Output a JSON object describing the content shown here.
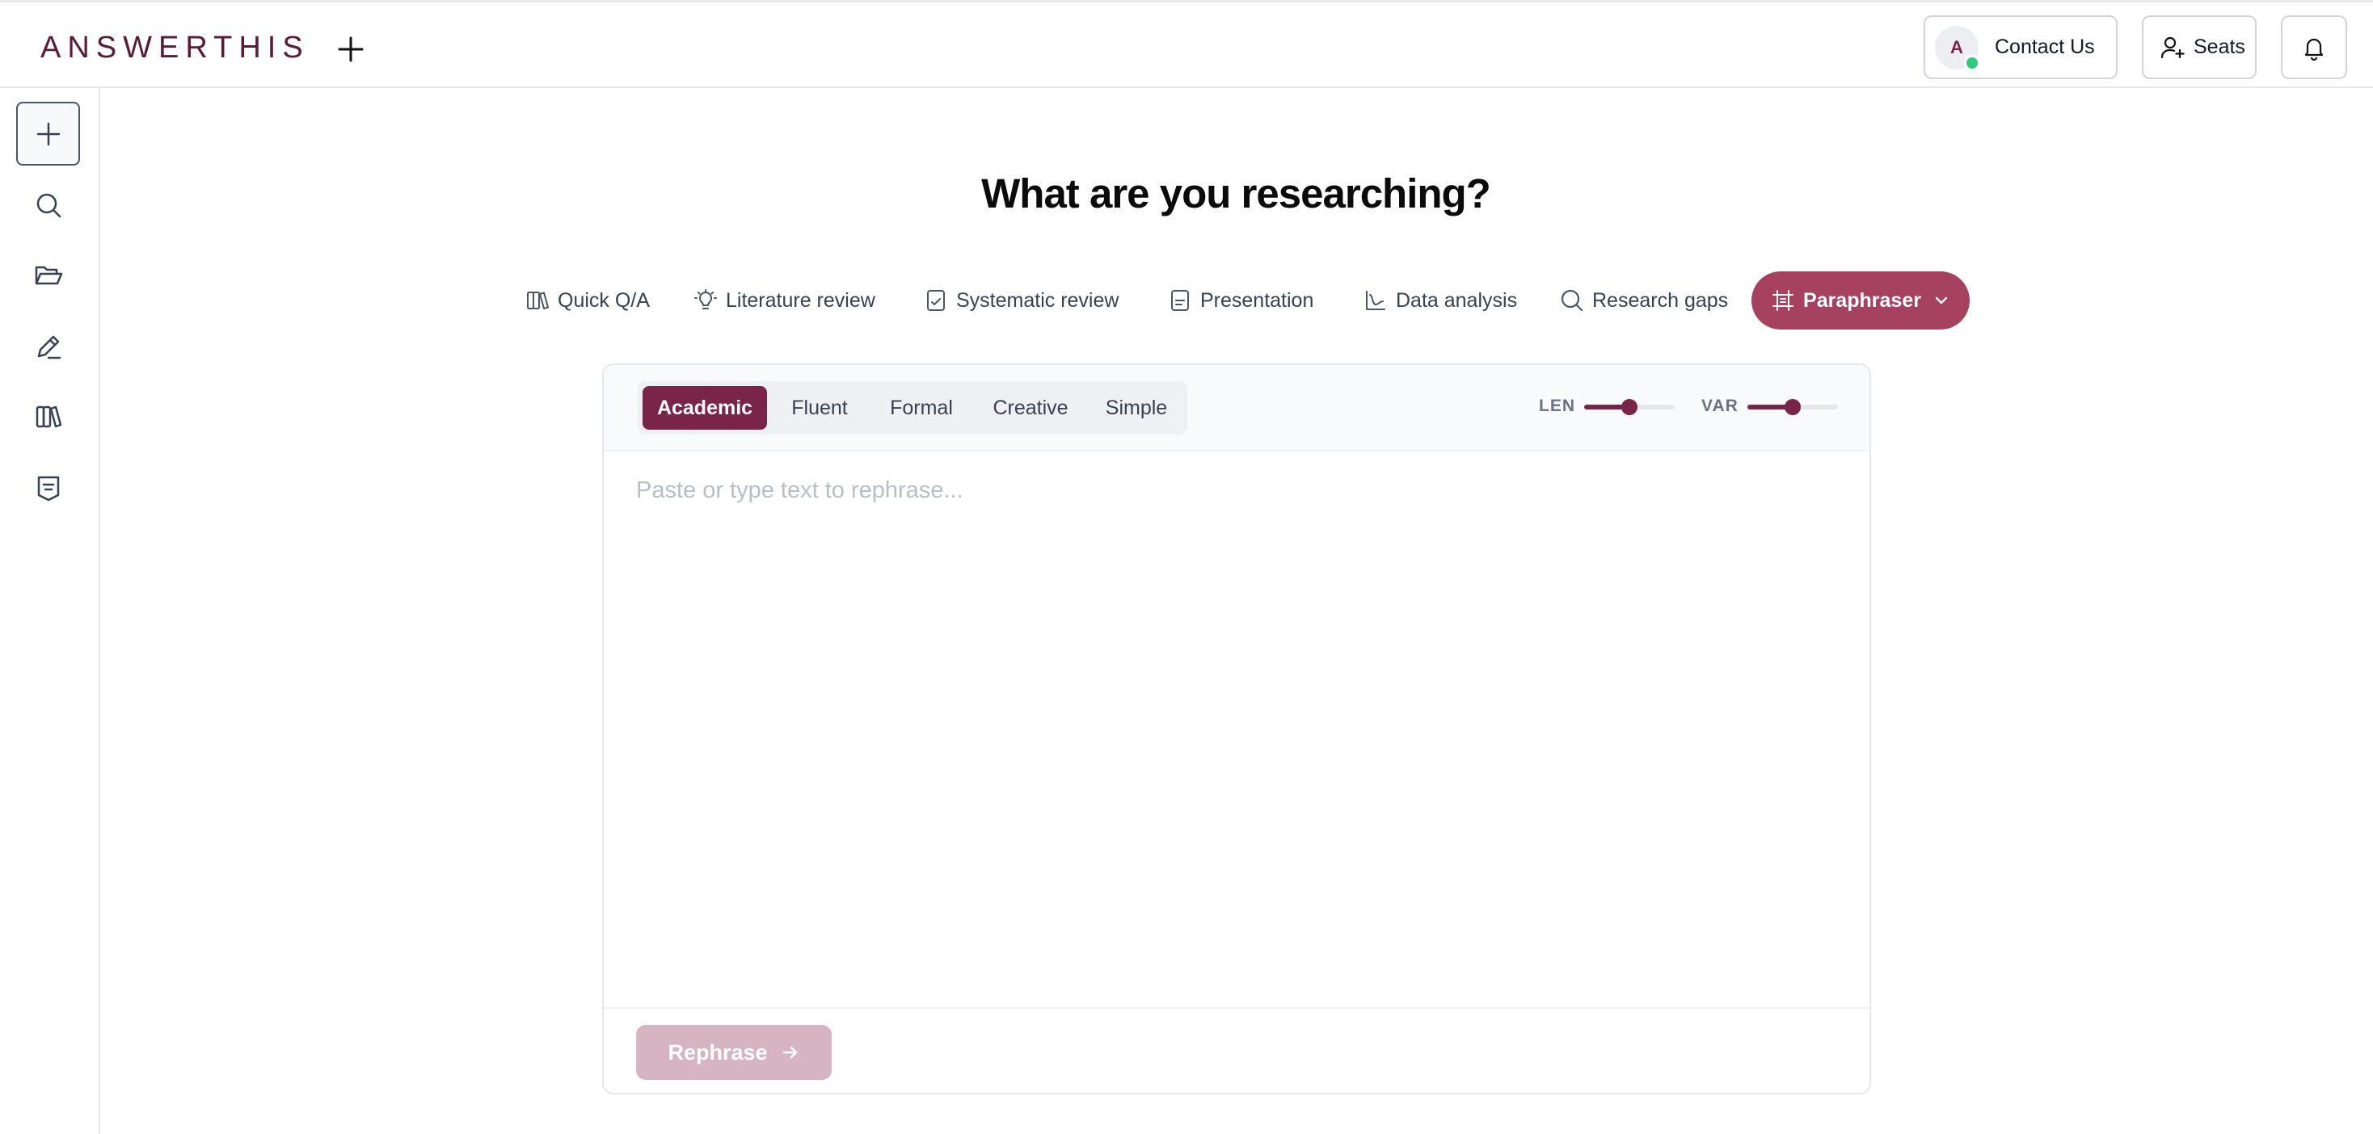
{
  "header": {
    "logo": "ANSWERTHIS",
    "new_icon": "plus-icon",
    "contact": {
      "avatar_letter": "A",
      "label": "Contact Us"
    },
    "seats_label": "Seats",
    "bell_icon": "bell-icon"
  },
  "sidebar": {
    "items": [
      {
        "name": "new-chat",
        "icon": "plus-icon",
        "active": true
      },
      {
        "name": "search",
        "icon": "search-icon"
      },
      {
        "name": "library",
        "icon": "folder-open-icon"
      },
      {
        "name": "write",
        "icon": "pencil-icon"
      },
      {
        "name": "books",
        "icon": "books-icon"
      },
      {
        "name": "notes",
        "icon": "bookmark-shield-icon"
      }
    ]
  },
  "main": {
    "title": "What are you researching?",
    "tabs": [
      {
        "label": "Quick Q/A",
        "icon": "books-icon"
      },
      {
        "label": "Literature review",
        "icon": "lightbulb-icon"
      },
      {
        "label": "Systematic review",
        "icon": "document-check-icon"
      },
      {
        "label": "Presentation",
        "icon": "document-icon"
      },
      {
        "label": "Data analysis",
        "icon": "chart-line-icon"
      },
      {
        "label": "Research gaps",
        "icon": "search-icon"
      },
      {
        "label": "Paraphraser",
        "icon": "frame-icon",
        "active": true
      }
    ]
  },
  "paraphraser": {
    "modes": [
      "Academic",
      "Fluent",
      "Formal",
      "Creative",
      "Simple"
    ],
    "active_mode": "Academic",
    "len_label": "LEN",
    "var_label": "VAR",
    "len_value": 0.5,
    "var_value": 0.5,
    "placeholder": "Paste or type text to rephrase...",
    "submit_label": "Rephrase"
  },
  "colors": {
    "brand": "#7a2449",
    "tab_active": "#a6415f",
    "submit_disabled": "#d6b4c1",
    "online": "#34c77b"
  }
}
